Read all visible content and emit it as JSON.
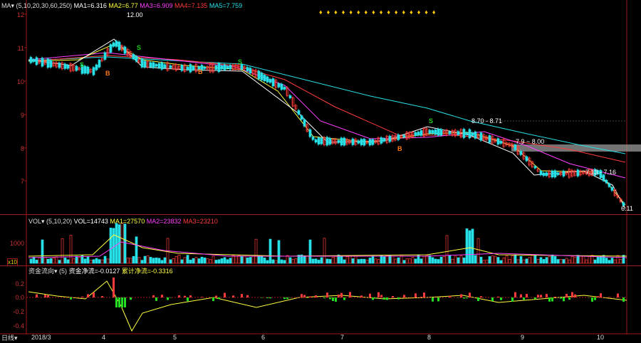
{
  "main": {
    "indicator": "MA",
    "params": "(5,10,20,30,60,250)",
    "ma1": "MA1=6.316",
    "ma2": "MA2=6.77",
    "ma3": "MA3=6.909",
    "ma4": "MA4=7.135",
    "ma5": "MA5=7.759",
    "y_ticks": [
      "12",
      "11",
      "10",
      "9",
      "8",
      "7"
    ],
    "annotations": {
      "high": "12.00",
      "mid_high": "8.70 - 8.71",
      "mid_low": "7.9 ~ 8.00",
      "last_high": "7.13 - 7.16",
      "last_low": "6.11"
    }
  },
  "volume": {
    "indicator": "VOL",
    "params": "(5,10,20)",
    "vol": "VOL=14743",
    "ma1": "MA1=27570",
    "ma2": "MA2=23832",
    "ma3": "MA3=23210",
    "y_tick": "1000",
    "unit": "x10"
  },
  "flow": {
    "indicator": "资金流向",
    "params": "(5)",
    "net": "资金净流=-0.0127",
    "cum": "累计净流=-0.3316",
    "y_ticks": [
      "0.2",
      "0.0",
      "-0.2",
      "-0.4"
    ]
  },
  "x_axis": {
    "period": "日线",
    "labels": [
      "2018/3",
      "4",
      "5",
      "6",
      "7",
      "8",
      "9",
      "10"
    ]
  },
  "colors": {
    "up": "#ff3b3b",
    "down": "#27e0e8",
    "ma1": "#ffffff",
    "ma2": "#ffff40",
    "ma3": "#ff40ff",
    "ma4": "#ff3b3b",
    "ma5": "#27e0e8",
    "buy": "#ff7a1a",
    "sell": "#22cc22"
  }
}
